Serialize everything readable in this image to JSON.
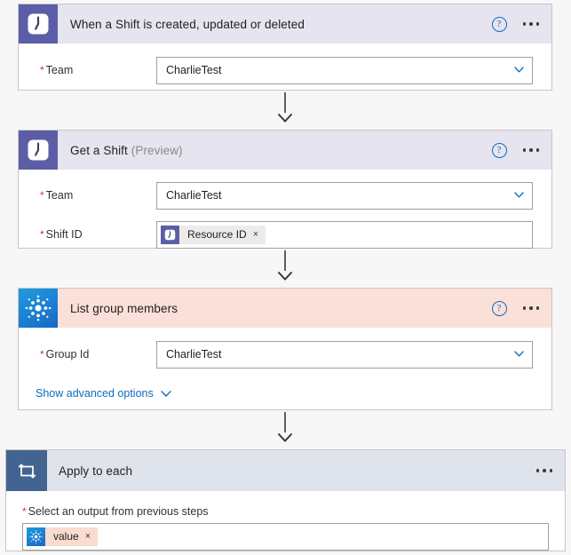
{
  "flow": {
    "cards": [
      {
        "id": "when-a-shift-is-created-updated-or-deleted",
        "title": "When a Shift is created, updated or deleted",
        "title_suffix": "",
        "icon": "shifts-clock-icon",
        "header_color": "#e6e4ef",
        "icon_bg": "#5b5ea6",
        "has_help": true,
        "has_ellipsis": true,
        "fields": [
          {
            "label": "Team",
            "required": true,
            "type": "dropdown",
            "value": "CharlieTest"
          }
        ]
      },
      {
        "id": "get-a-shift",
        "title": "Get a Shift",
        "title_suffix": "(Preview)",
        "icon": "shifts-clock-icon",
        "header_color": "#e6e4ef",
        "icon_bg": "#5b5ea6",
        "has_help": true,
        "has_ellipsis": true,
        "fields": [
          {
            "label": "Team",
            "required": true,
            "type": "dropdown",
            "value": "CharlieTest"
          },
          {
            "label": "Shift ID",
            "required": true,
            "type": "token",
            "token": {
              "label": "Resource ID",
              "icon": "shifts-clock-icon",
              "chip_color": "#edebe9",
              "remove_label": "×"
            }
          }
        ]
      },
      {
        "id": "list-group-members",
        "title": "List group members",
        "title_suffix": "",
        "icon": "azure-ad-icon",
        "header_color": "#fae0d9",
        "icon_bg": "#1b7fd4",
        "has_help": true,
        "has_ellipsis": true,
        "fields": [
          {
            "label": "Group Id",
            "required": true,
            "type": "dropdown",
            "value": "CharlieTest"
          }
        ],
        "advanced_link": "Show advanced options"
      },
      {
        "id": "apply-to-each",
        "title": "Apply to each",
        "title_suffix": "",
        "icon": "loop-repeat-icon",
        "header_color": "#dfe3ec",
        "icon_bg": "#426491",
        "has_help": false,
        "has_ellipsis": true,
        "output_label": "Select an output from previous steps",
        "output_required": true,
        "output_token": {
          "label": "value",
          "icon": "azure-ad-icon",
          "chip_color": "#fadbd0",
          "remove_label": "×"
        }
      }
    ],
    "connectors": [
      {
        "name": "connector-arrow-1"
      },
      {
        "name": "connector-arrow-2"
      },
      {
        "name": "connector-arrow-3"
      }
    ],
    "icons": {
      "help": "?",
      "chevron_down": "chevron-down-icon",
      "ellipsis": "ellipsis-icon"
    }
  }
}
